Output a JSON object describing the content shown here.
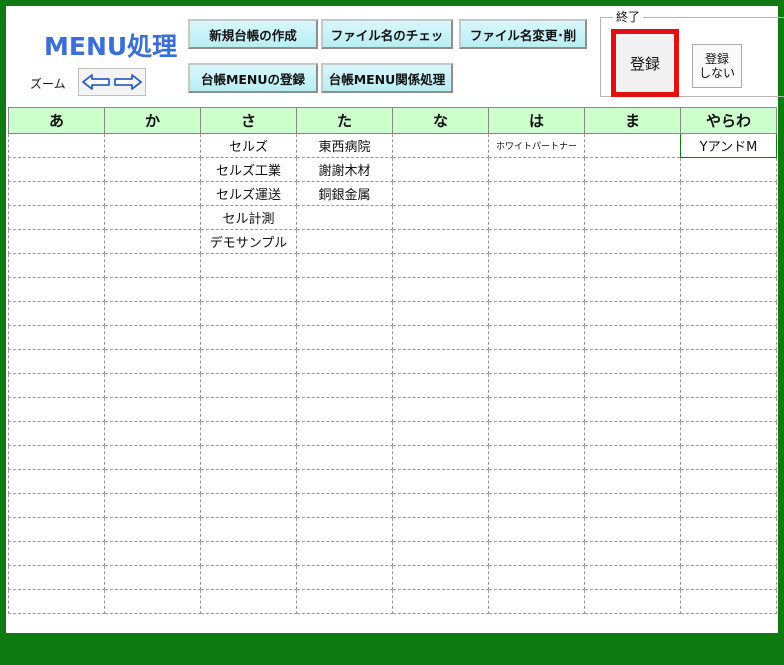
{
  "app": {
    "title": "MENU処理",
    "zoom_label": "ズーム"
  },
  "toolbar": {
    "row1": [
      "新規台帳の作成",
      "ファイル名のチェッ",
      "ファイル名変更･削"
    ],
    "row2": [
      "台帳MENUの登録",
      "台帳MENU関係処理"
    ]
  },
  "exit": {
    "legend": "終了",
    "register_label": "登録",
    "no_register_label": "登録\nしない"
  },
  "colors": {
    "frame": "#0f7a12",
    "header": "#ccffcc",
    "button": "#c4f1f6",
    "title": "#3a6fd8",
    "highlight": "#e01010"
  },
  "grid": {
    "headers": [
      "あ",
      "か",
      "さ",
      "た",
      "な",
      "は",
      "ま",
      "やらわ"
    ],
    "rows": [
      [
        "",
        "",
        "セルズ",
        "東西病院",
        "",
        "ホワイトパートナー",
        "",
        "YアンドM"
      ],
      [
        "",
        "",
        "セルズ工業",
        "謝謝木材",
        "",
        "",
        "",
        ""
      ],
      [
        "",
        "",
        "セルズ運送",
        "銅銀金属",
        "",
        "",
        "",
        ""
      ],
      [
        "",
        "",
        "セル計測",
        "",
        "",
        "",
        "",
        ""
      ],
      [
        "",
        "",
        "デモサンプル",
        "",
        "",
        "",
        "",
        ""
      ],
      [
        "",
        "",
        "",
        "",
        "",
        "",
        "",
        ""
      ],
      [
        "",
        "",
        "",
        "",
        "",
        "",
        "",
        ""
      ],
      [
        "",
        "",
        "",
        "",
        "",
        "",
        "",
        ""
      ],
      [
        "",
        "",
        "",
        "",
        "",
        "",
        "",
        ""
      ],
      [
        "",
        "",
        "",
        "",
        "",
        "",
        "",
        ""
      ],
      [
        "",
        "",
        "",
        "",
        "",
        "",
        "",
        ""
      ],
      [
        "",
        "",
        "",
        "",
        "",
        "",
        "",
        ""
      ],
      [
        "",
        "",
        "",
        "",
        "",
        "",
        "",
        ""
      ],
      [
        "",
        "",
        "",
        "",
        "",
        "",
        "",
        ""
      ],
      [
        "",
        "",
        "",
        "",
        "",
        "",
        "",
        ""
      ],
      [
        "",
        "",
        "",
        "",
        "",
        "",
        "",
        ""
      ],
      [
        "",
        "",
        "",
        "",
        "",
        "",
        "",
        ""
      ],
      [
        "",
        "",
        "",
        "",
        "",
        "",
        "",
        ""
      ],
      [
        "",
        "",
        "",
        "",
        "",
        "",
        "",
        ""
      ],
      [
        "",
        "",
        "",
        "",
        "",
        "",
        "",
        ""
      ]
    ]
  }
}
